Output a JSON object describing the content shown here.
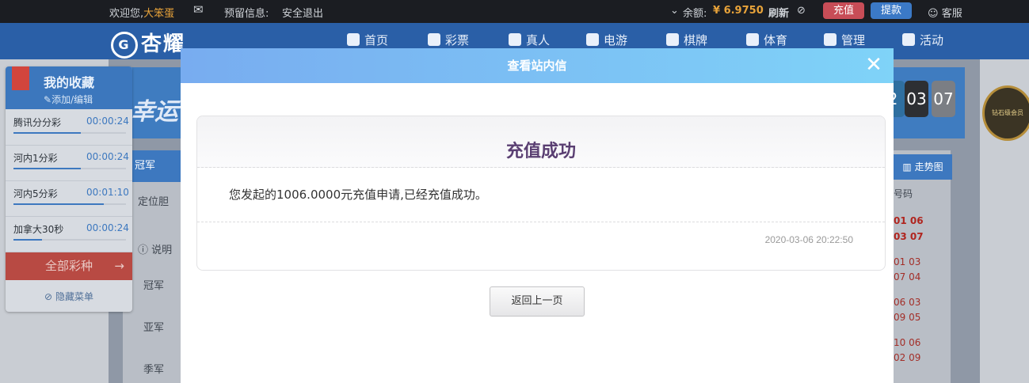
{
  "topbar": {
    "welcome": "欢迎您,",
    "username": "大笨蛋",
    "reserve_info": "预留信息:",
    "logout": "安全退出",
    "balance_label": "余额:",
    "balance_value": "¥ 6.9750",
    "refresh": "刷新",
    "recharge": "充值",
    "withdraw": "提款",
    "service": "客服"
  },
  "nav": {
    "logo": "杏耀",
    "items": [
      "首页",
      "彩票",
      "真人",
      "电游",
      "棋牌",
      "体育",
      "管理",
      "活动"
    ]
  },
  "favorites": {
    "title": "我的收藏",
    "edit": "添加/编辑",
    "items": [
      {
        "name": "腾讯分分彩",
        "time": "00:00:24",
        "progress": 0.6
      },
      {
        "name": "河内1分彩",
        "time": "00:00:24",
        "progress": 0.6
      },
      {
        "name": "河内5分彩",
        "time": "00:01:10",
        "progress": 0.8
      },
      {
        "name": "加拿大30秒",
        "time": "00:00:24",
        "progress": 0.25
      }
    ],
    "all": "全部彩种",
    "hide": "隐藏菜单"
  },
  "background": {
    "banner": "幸运",
    "tabs": [
      "冠军",
      "定位胆"
    ],
    "labels": [
      "说明",
      "冠军",
      "亚军",
      "季军"
    ],
    "trend": "走势图",
    "number_col": "号码",
    "clock": [
      "2",
      "03",
      "07"
    ],
    "results": [
      "01 06",
      "03 07",
      "01 03",
      "07 04",
      "06 03",
      "09 05",
      "10 06",
      "02 09"
    ],
    "badge": "钻石级会员"
  },
  "modal": {
    "title": "查看站内信",
    "message_title": "充值成功",
    "message_body": "您发起的1006.0000元充值申请,已经充值成功。",
    "date": "2020-03-06 20:22:50",
    "back": "返回上一页"
  },
  "colors": {
    "modal_header_start": "#78acf0",
    "modal_header_end": "#7fd3f8",
    "message_title": "#5a3f72",
    "recharge": "#c84d57",
    "withdraw": "#3b79c6"
  }
}
